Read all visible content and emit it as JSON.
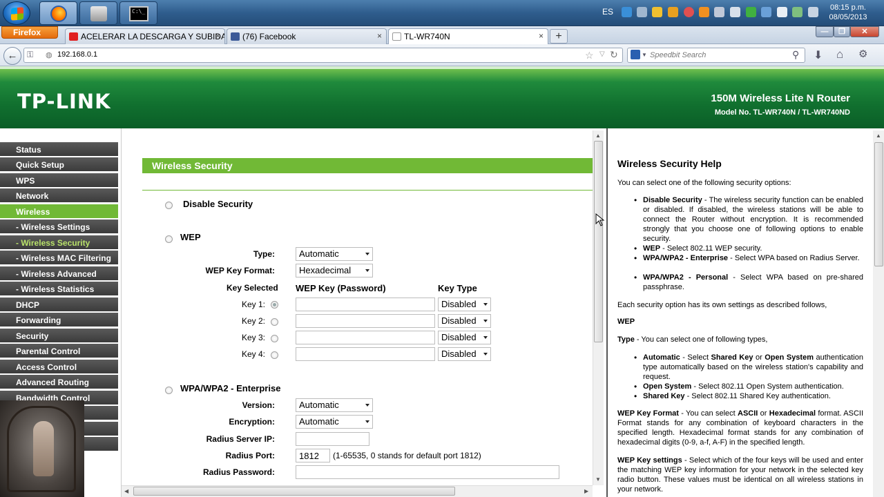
{
  "taskbar": {
    "language": "ES",
    "clock_time": "08:15 p.m.",
    "clock_date": "08/05/2013"
  },
  "browser": {
    "menu_button": "Firefox",
    "tabs": [
      {
        "label": "ACELERAR LA DESCARGA Y SUBIDA ...",
        "icon": "youtube-icon"
      },
      {
        "label": "(76) Facebook",
        "icon": "facebook-icon"
      },
      {
        "label": "TL-WR740N",
        "icon": "page-icon"
      }
    ],
    "url": "192.168.0.1",
    "search_placeholder": "Speedbit Search"
  },
  "header": {
    "logo": "TP-LINK",
    "product": "150M Wireless Lite N Router",
    "model": "Model No. TL-WR740N / TL-WR740ND"
  },
  "sidebar": {
    "items": [
      {
        "label": "Status"
      },
      {
        "label": "Quick Setup"
      },
      {
        "label": "WPS"
      },
      {
        "label": "Network"
      },
      {
        "label": "Wireless"
      },
      {
        "label": "- Wireless Settings"
      },
      {
        "label": "- Wireless Security"
      },
      {
        "label": "- Wireless MAC Filtering"
      },
      {
        "label": "- Wireless Advanced"
      },
      {
        "label": "- Wireless Statistics"
      },
      {
        "label": "DHCP"
      },
      {
        "label": "Forwarding"
      },
      {
        "label": "Security"
      },
      {
        "label": "Parental Control"
      },
      {
        "label": "Access Control"
      },
      {
        "label": "Advanced Routing"
      },
      {
        "label": "Bandwidth Control"
      }
    ]
  },
  "main": {
    "section_title": "Wireless Security",
    "disable_security": "Disable Security",
    "wep": {
      "title": "WEP",
      "type_label": "Type:",
      "type_value": "Automatic",
      "format_label": "WEP Key Format:",
      "format_value": "Hexadecimal",
      "key_selected_head": "Key Selected",
      "wep_key_head": "WEP Key (Password)",
      "key_type_head": "Key Type",
      "keys": [
        {
          "label": "Key 1:",
          "value": "",
          "type": "Disabled"
        },
        {
          "label": "Key 2:",
          "value": "",
          "type": "Disabled"
        },
        {
          "label": "Key 3:",
          "value": "",
          "type": "Disabled"
        },
        {
          "label": "Key 4:",
          "value": "",
          "type": "Disabled"
        }
      ]
    },
    "enterprise": {
      "title": "WPA/WPA2 - Enterprise",
      "version_label": "Version:",
      "version_value": "Automatic",
      "encryption_label": "Encryption:",
      "encryption_value": "Automatic",
      "radius_ip_label": "Radius Server IP:",
      "radius_ip_value": "",
      "radius_port_label": "Radius Port:",
      "radius_port_value": "1812",
      "radius_port_hint": "(1-65535, 0 stands for default port 1812)",
      "radius_pw_label": "Radius Password:",
      "radius_pw_value": ""
    }
  },
  "help": {
    "title": "Wireless Security Help",
    "intro": "You can select one of the following security options:",
    "options": [
      {
        "term": "Disable Security",
        "text": " - The wireless security function can be enabled or disabled. If disabled, the wireless stations will be able to connect the Router without encryption. It is recommended strongly that you choose one of following options to enable security."
      },
      {
        "term": "WEP",
        "text": " - Select 802.11 WEP security."
      },
      {
        "term": "WPA/WPA2 - Enterprise",
        "text": " - Select WPA based on Radius Server."
      },
      {
        "term": "WPA/WPA2 - Personal",
        "text": " - Select WPA based on pre-shared passphrase."
      }
    ],
    "each_option": "Each security option has its own settings as described follows,",
    "wep_heading": "WEP",
    "type_term": "Type",
    "type_text": " - You can select one of following types,",
    "types": [
      {
        "term": "Automatic",
        "text": " - Select ",
        "term2": "Shared Key",
        "mid": " or ",
        "term3": "Open System",
        "tail": " authentication type automatically based on the wireless station's capability and request."
      },
      {
        "term": "Open System",
        "text": " - Select 802.11 Open System authentication."
      },
      {
        "term": "Shared Key",
        "text": " - Select 802.11 Shared Key authentication."
      }
    ],
    "wep_format_term": "WEP Key Format",
    "wep_format_text1": " - You can select ",
    "wep_format_ascii": "ASCII",
    "wep_format_or": " or ",
    "wep_format_hex": "Hexadecimal",
    "wep_format_text2": " format. ASCII Format stands for any combination of keyboard characters in the specified length. Hexadecimal format stands for any combination of hexadecimal digits (0-9, a-f, A-F) in the specified length.",
    "wep_settings_term": "WEP Key settings",
    "wep_settings_text": " - Select which of the four keys will be used and enter the matching WEP key information for your network in the selected key radio button. These values must be identical on all wireless stations in your network."
  }
}
